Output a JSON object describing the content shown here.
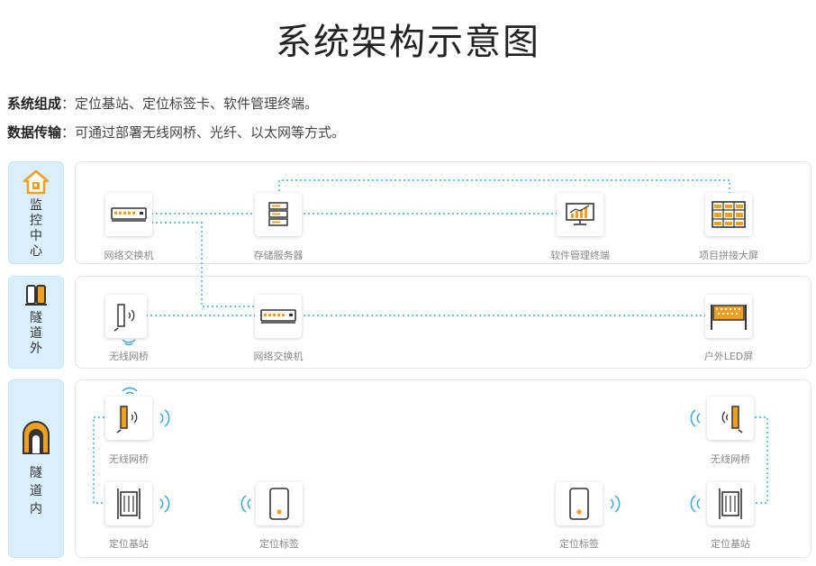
{
  "title": "系统架构示意图",
  "composition": {
    "label": "系统组成",
    "text": "：定位基站、定位标签卡、软件管理终端。"
  },
  "transmission": {
    "label": "数据传输",
    "text": "：可通过部署无线网桥、光纤、以太网等方式。"
  },
  "bands": {
    "monitor": {
      "label": "监控中心"
    },
    "outside": {
      "label": "隧道外"
    },
    "inside": {
      "label": "隧道内"
    }
  },
  "devices": {
    "switch_monitor": "网络交换机",
    "storage_server": "存储服务器",
    "software_terminal": "软件管理终端",
    "video_wall": "项目拼接大屏",
    "bridge_outside": "无线网桥",
    "switch_outside": "网络交换机",
    "led_screen": "户外LED屏",
    "bridge_inside_left": "无线网桥",
    "bridge_inside_right": "无线网桥",
    "base_station_left": "定位基站",
    "tag_left": "定位标签",
    "tag_right": "定位标签",
    "base_station_right": "定位基站"
  },
  "colors": {
    "accent_blue": "#3ba7d8",
    "accent_orange": "#f0a020",
    "band_bg": "#d9f0fc"
  },
  "icons": {
    "monitor": "home-shield-icon",
    "outside": "tunnel-exterior-icon",
    "inside": "tunnel-arch-icon"
  }
}
